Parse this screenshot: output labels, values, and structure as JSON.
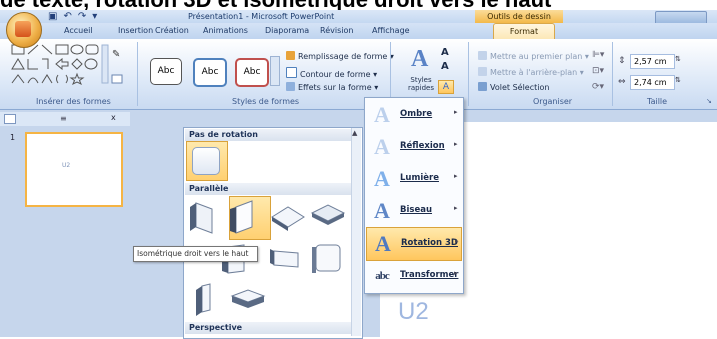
{
  "banner": "de texte, rotation 3D et isométrique droit vers le haut",
  "title_bar": {
    "title": "Présentation1 - Microsoft PowerPoint",
    "context_tab": "Outils de dessin"
  },
  "tabs": [
    "Accueil",
    "Insertion",
    "Création",
    "Animations",
    "Diaporama",
    "Révision",
    "Affichage"
  ],
  "active_tab": "Format",
  "ribbon": {
    "group_insert": "Insérer des formes",
    "group_styles": "Styles de formes",
    "abc": "Abc",
    "fill": "Remplissage de forme",
    "outline": "Contour de forme",
    "effects": "Effets sur la forme",
    "quick_styles": "Styles rapides",
    "bring_front": "Mettre au premier plan",
    "send_back": "Mettre à l'arrière-plan",
    "selection_pane": "Volet Sélection",
    "group_arrange": "Organiser",
    "height": "2,57 cm",
    "width": "2,74 cm",
    "group_size": "Taille"
  },
  "workspace": {
    "slide_number": "1",
    "thumb_text": "U2",
    "slide_text": "U2"
  },
  "gallery": {
    "section_none": "Pas de rotation",
    "section_parallel": "Parallèle",
    "section_perspective": "Perspective",
    "tooltip": "Isométrique droit vers le haut"
  },
  "menu": {
    "items": [
      {
        "label": "Ombre",
        "icon": "shadow-icon"
      },
      {
        "label": "Réflexion",
        "icon": "reflection-icon"
      },
      {
        "label": "Lumière",
        "icon": "glow-icon"
      },
      {
        "label": "Biseau",
        "icon": "bevel-icon"
      },
      {
        "label": "Rotation 3D",
        "icon": "rotation-3d-icon"
      },
      {
        "label": "Transformer",
        "icon": "transform-icon"
      }
    ],
    "active_index": 4
  },
  "colors": {
    "accent_orange": "#f5b444",
    "ribbon_blue": "#dbe7f7",
    "workspace_blue": "#c6d6ec"
  }
}
